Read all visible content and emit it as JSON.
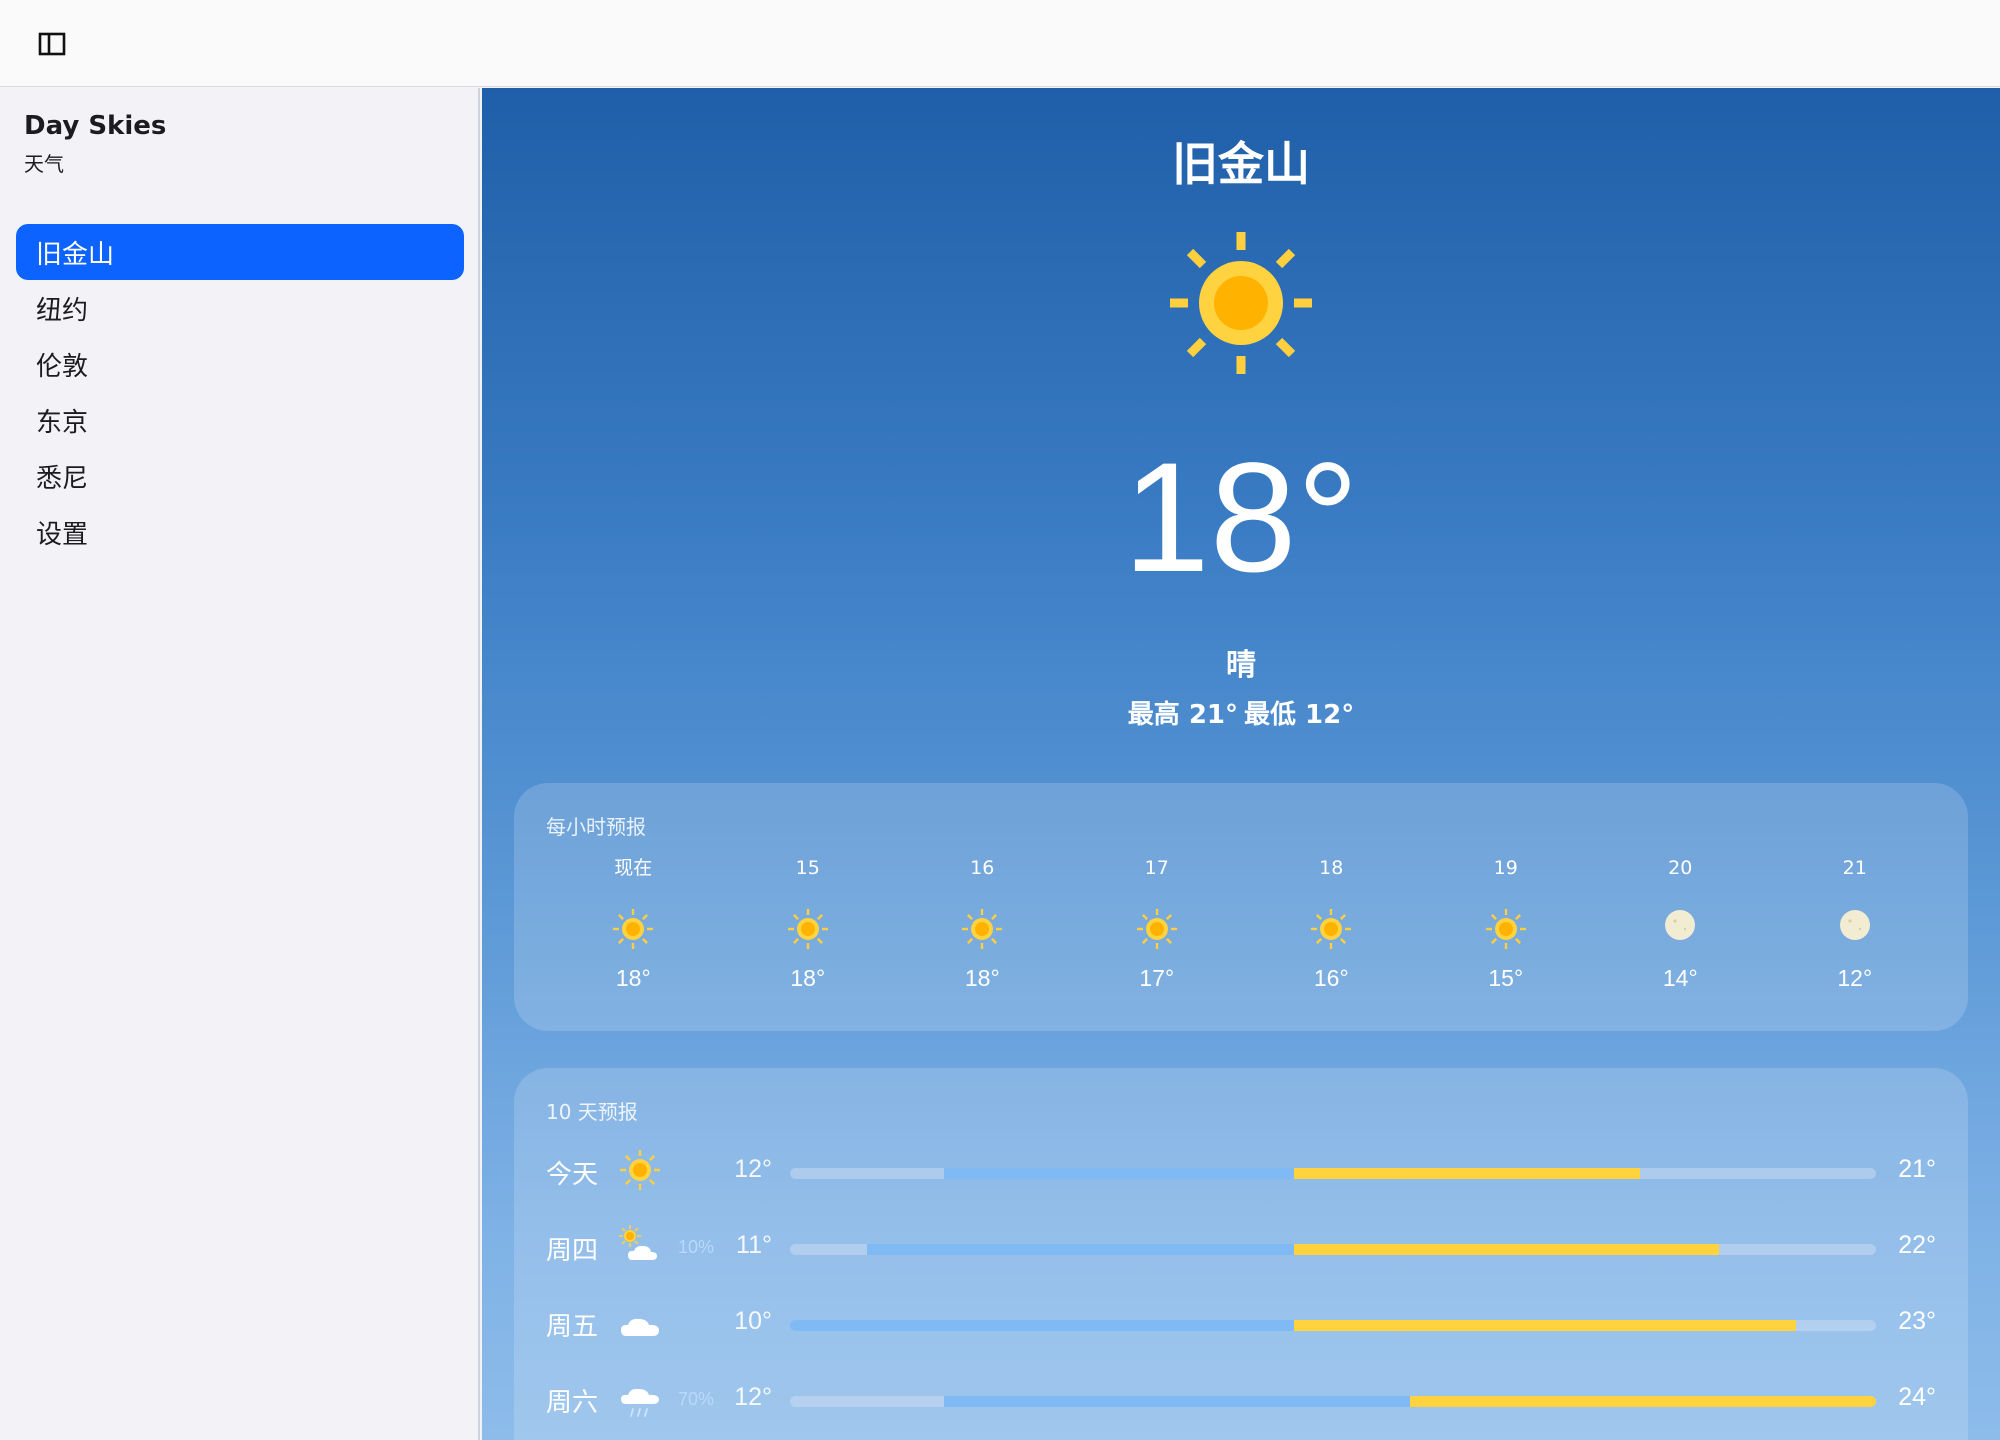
{
  "app": {
    "title": "Day Skies",
    "subtitle": "天气"
  },
  "sidebar": {
    "items": [
      {
        "label": "旧金山",
        "active": true
      },
      {
        "label": "纽约",
        "active": false
      },
      {
        "label": "伦敦",
        "active": false
      },
      {
        "label": "东京",
        "active": false
      },
      {
        "label": "悉尼",
        "active": false
      },
      {
        "label": "设置",
        "active": false
      }
    ]
  },
  "current": {
    "city": "旧金山",
    "temp": "18°",
    "condition": "晴",
    "high": "最高 21°",
    "low": "最低 12°",
    "icon": "sun-icon"
  },
  "hourly": {
    "title": "每小时预报",
    "items": [
      {
        "label": "现在",
        "icon": "sun",
        "temp": "18°"
      },
      {
        "label": "15",
        "icon": "sun",
        "temp": "18°"
      },
      {
        "label": "16",
        "icon": "sun",
        "temp": "18°"
      },
      {
        "label": "17",
        "icon": "sun",
        "temp": "17°"
      },
      {
        "label": "18",
        "icon": "sun",
        "temp": "16°"
      },
      {
        "label": "19",
        "icon": "sun",
        "temp": "15°"
      },
      {
        "label": "20",
        "icon": "moon",
        "temp": "14°"
      },
      {
        "label": "21",
        "icon": "moon",
        "temp": "12°"
      }
    ]
  },
  "daily": {
    "title": "10 天预报",
    "items": [
      {
        "day": "今天",
        "icon": "sun",
        "precip": "",
        "low": "12°",
        "high": "21°",
        "low_value": 12,
        "high_value": 21
      },
      {
        "day": "周四",
        "icon": "partly-cloudy",
        "precip": "10%",
        "low": "11°",
        "high": "22°",
        "low_value": 11,
        "high_value": 22
      },
      {
        "day": "周五",
        "icon": "cloud",
        "precip": "",
        "low": "10°",
        "high": "23°",
        "low_value": 10,
        "high_value": 23
      },
      {
        "day": "周六",
        "icon": "rain",
        "precip": "70%",
        "low": "12°",
        "high": "24°",
        "low_value": 12,
        "high_value": 24
      }
    ]
  },
  "colors": {
    "accent": "#0d63ff",
    "sun": "#ffc62f",
    "warm_bar": "#ffd33d",
    "cool_bar": "#7fbaf5"
  }
}
